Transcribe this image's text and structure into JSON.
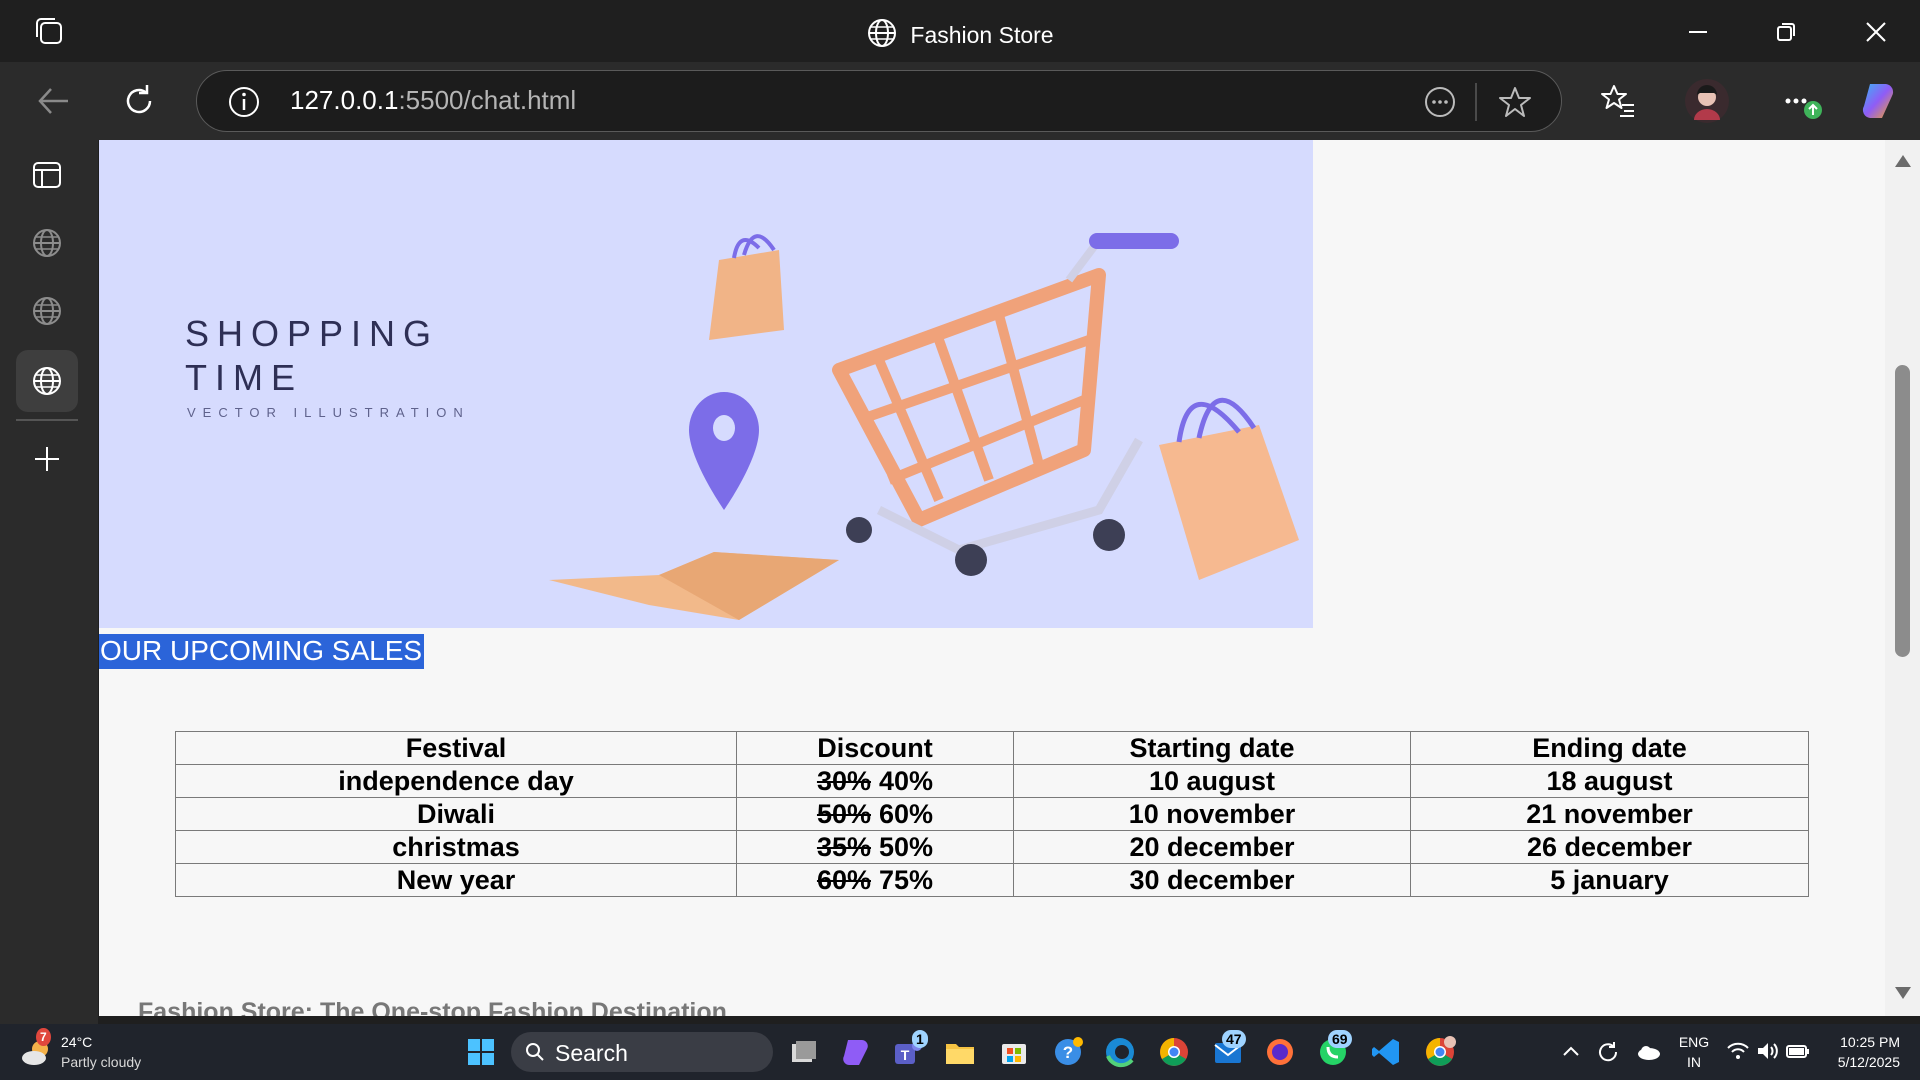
{
  "browser": {
    "window_title": "Fashion Store",
    "url_host": "127.0.0.1",
    "url_path": ":5500/chat.html"
  },
  "banner": {
    "heading_line1": "SHOPPING",
    "heading_line2": "TIME",
    "subheading": "VECTOR ILLUSTRATION"
  },
  "page": {
    "sales_title": "OUR UPCOMING SALES",
    "footer_text": "Fashion Store: The One-stop Fashion Destination"
  },
  "sales_table": {
    "headers": [
      "Festival",
      "Discount",
      "Starting date",
      "Ending date"
    ],
    "rows": [
      {
        "festival": "independence day",
        "old_discount": "30%",
        "new_discount": "40%",
        "start": "10 august",
        "end": "18 august"
      },
      {
        "festival": "Diwali",
        "old_discount": "50%",
        "new_discount": "60%",
        "start": "10 november",
        "end": "21 november"
      },
      {
        "festival": "christmas",
        "old_discount": "35%",
        "new_discount": "50%",
        "start": "20 december",
        "end": "26 december"
      },
      {
        "festival": "New year",
        "old_discount": "60%",
        "new_discount": "75%",
        "start": "30 december",
        "end": "5 january"
      }
    ]
  },
  "taskbar": {
    "weather_badge": "7",
    "temperature": "24°C",
    "condition": "Partly cloudy",
    "search_label": "Search",
    "teams_badge": "1",
    "mail_badge": "47",
    "whatsapp_badge": "69",
    "language_line1": "ENG",
    "language_line2": "IN",
    "time": "10:25 PM",
    "date": "5/12/2025"
  },
  "colors": {
    "banner_bg": "#d6dbfe",
    "selection": "#2b64d9",
    "browser_chrome": "#2b2b2b"
  }
}
